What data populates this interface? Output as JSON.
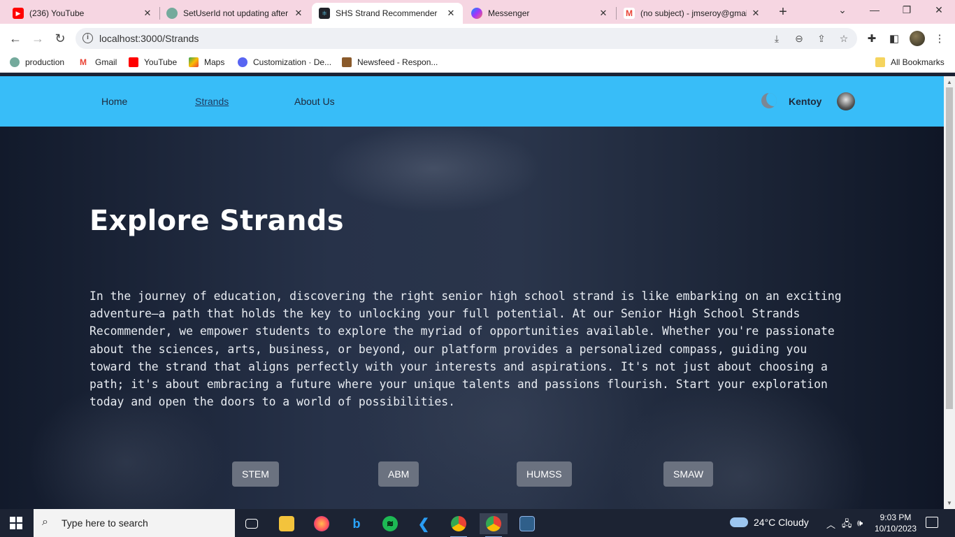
{
  "browser": {
    "tabs": [
      {
        "title": "(236) YouTube",
        "favicon": "youtube-icon",
        "color": "#ff0000"
      },
      {
        "title": "SetUserId not updating after",
        "favicon": "chatgpt-icon",
        "color": "#74aa9c"
      },
      {
        "title": "SHS Strand Recommender",
        "favicon": "react-icon",
        "color": "#61dafb"
      },
      {
        "title": "Messenger",
        "favicon": "messenger-icon",
        "color": "#a033ff"
      },
      {
        "title": "(no subject) - jmseroy@gmail",
        "favicon": "gmail-icon",
        "color": "#ea4335"
      }
    ],
    "url": "localhost:3000/Strands",
    "bookmarks": [
      {
        "label": "production",
        "icon": "chatgpt-icon",
        "color": "#74aa9c"
      },
      {
        "label": "Gmail",
        "icon": "gmail-icon",
        "color": "#ea4335"
      },
      {
        "label": "YouTube",
        "icon": "youtube-icon",
        "color": "#ff0000"
      },
      {
        "label": "Maps",
        "icon": "maps-icon",
        "color": "#34a853"
      },
      {
        "label": "Customization · De...",
        "icon": "discord-icon",
        "color": "#5865f2"
      },
      {
        "label": "Newsfeed - Respon...",
        "icon": "newsfeed-icon",
        "color": "#8a5a2b"
      }
    ],
    "all_bookmarks": "All Bookmarks"
  },
  "site": {
    "nav": {
      "home": "Home",
      "strands": "Strands",
      "about": "About Us"
    },
    "username": "Kentoy",
    "hero": {
      "title": "Explore Strands",
      "body": "In the journey of education, discovering the right senior high school strand is like embarking on an exciting adventure—a path that holds the key to unlocking your full potential. At our Senior High School Strands Recommender, we empower students to explore the myriad of opportunities available. Whether you're passionate about the sciences, arts, business, or beyond, our platform provides a personalized compass, guiding you toward the strand that aligns perfectly with your interests and aspirations. It's not just about choosing a path; it's about embracing a future where your unique talents and passions flourish. Start your exploration today and open the doors to a world of possibilities."
    },
    "strands": [
      "STEM",
      "ABM",
      "HUMSS",
      "SMAW"
    ],
    "accent": "#38bdf8"
  },
  "taskbar": {
    "search_placeholder": "Type here to search",
    "weather": "24°C  Cloudy",
    "time": "9:03 PM",
    "date": "10/10/2023"
  }
}
